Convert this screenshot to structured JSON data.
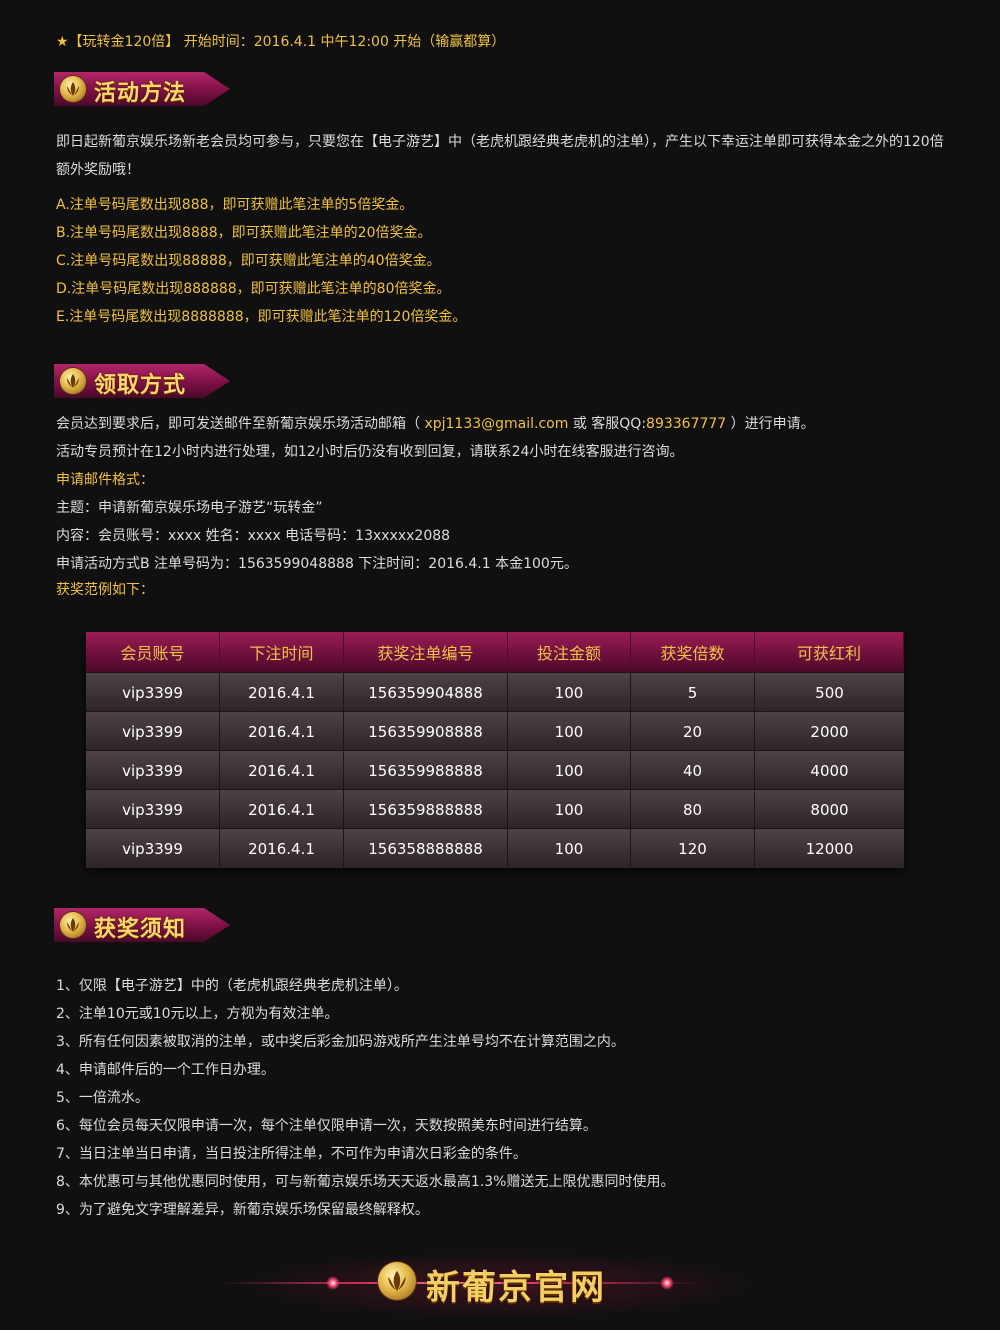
{
  "header": {
    "intro_line": "★【玩转金120倍】 开始时间：2016.4.1  中午12:00 开始（输赢都算）"
  },
  "sections": {
    "method_title": "活动方法",
    "claim_title": "领取方式",
    "notice_title": "获奖须知"
  },
  "method": {
    "paragraph": "即日起新葡京娱乐场新老会员均可参与，只要您在【电子游艺】中（老虎机跟经典老虎机的注单），产生以下幸运注单即可获得本金之外的120倍额外奖励哦！",
    "rules": [
      "A.注单号码尾数出现888，即可获赠此笔注单的5倍奖金。",
      "B.注单号码尾数出现8888，即可获赠此笔注单的20倍奖金。",
      "C.注单号码尾数出现88888，即可获赠此笔注单的40倍奖金。",
      "D.注单号码尾数出现888888，即可获赠此笔注单的80倍奖金。",
      "E.注单号码尾数出现8888888，即可获赠此笔注单的120倍奖金。"
    ]
  },
  "claim": {
    "line1_prefix": "会员达到要求后，即可发送邮件至新葡京娱乐场活动邮箱（",
    "email": " xpj1133@gmail.com ",
    "line1_or": "或 客服QQ:",
    "qq": "893367777",
    "line1_suffix": " ）进行申请。",
    "line2": "活动专员预计在12小时内进行处理，如12小时后仍没有收到回复，请联系24小时在线客服进行咨询。",
    "format_label": "申请邮件格式：",
    "subject": "主题：申请新葡京娱乐场电子游艺“玩转金”",
    "content": "内容：会员账号：xxxx 姓名：xxxx 电话号码：13xxxxx2088",
    "apply": "申请活动方式B 注单号码为：1563599048888 下注时间：2016.4.1 本金100元。",
    "example_label": "获奖范例如下："
  },
  "table": {
    "headers": [
      "会员账号",
      "下注时间",
      "获奖注单编号",
      "投注金额",
      "获奖倍数",
      "可获红利"
    ],
    "rows": [
      [
        "vip3399",
        "2016.4.1",
        "156359904888",
        "100",
        "5",
        "500"
      ],
      [
        "vip3399",
        "2016.4.1",
        "156359908888",
        "100",
        "20",
        "2000"
      ],
      [
        "vip3399",
        "2016.4.1",
        "156359988888",
        "100",
        "40",
        "4000"
      ],
      [
        "vip3399",
        "2016.4.1",
        "156359888888",
        "100",
        "80",
        "8000"
      ],
      [
        "vip3399",
        "2016.4.1",
        "156358888888",
        "100",
        "120",
        "12000"
      ]
    ]
  },
  "notice": {
    "items": [
      "1、仅限【电子游艺】中的（老虎机跟经典老虎机注单）。",
      "2、注单10元或10元以上，方视为有效注单。",
      "3、所有任何因素被取消的注单，或中奖后彩金加码游戏所产生注单号均不在计算范围之内。",
      "4、申请邮件后的一个工作日办理。",
      "5、一倍流水。",
      "6、每位会员每天仅限申请一次，每个注单仅限申请一次，天数按照美东时间进行结算。",
      "7、当日注单当日申请，当日投注所得注单，不可作为申请次日彩金的条件。",
      "8、本优惠可与其他优惠同时使用，可与新葡京娱乐场天天返水最高1.3%赠送无上限优惠同时使用。",
      "9、为了避免文字理解差异，新葡京娱乐场保留最终解释权。"
    ]
  },
  "footer": {
    "brand": "新葡京官网"
  },
  "colors": {
    "background": "#101010",
    "gold": "#f0c040",
    "banner_magenta": "#9c1d55",
    "table_row": "#3a3034"
  }
}
